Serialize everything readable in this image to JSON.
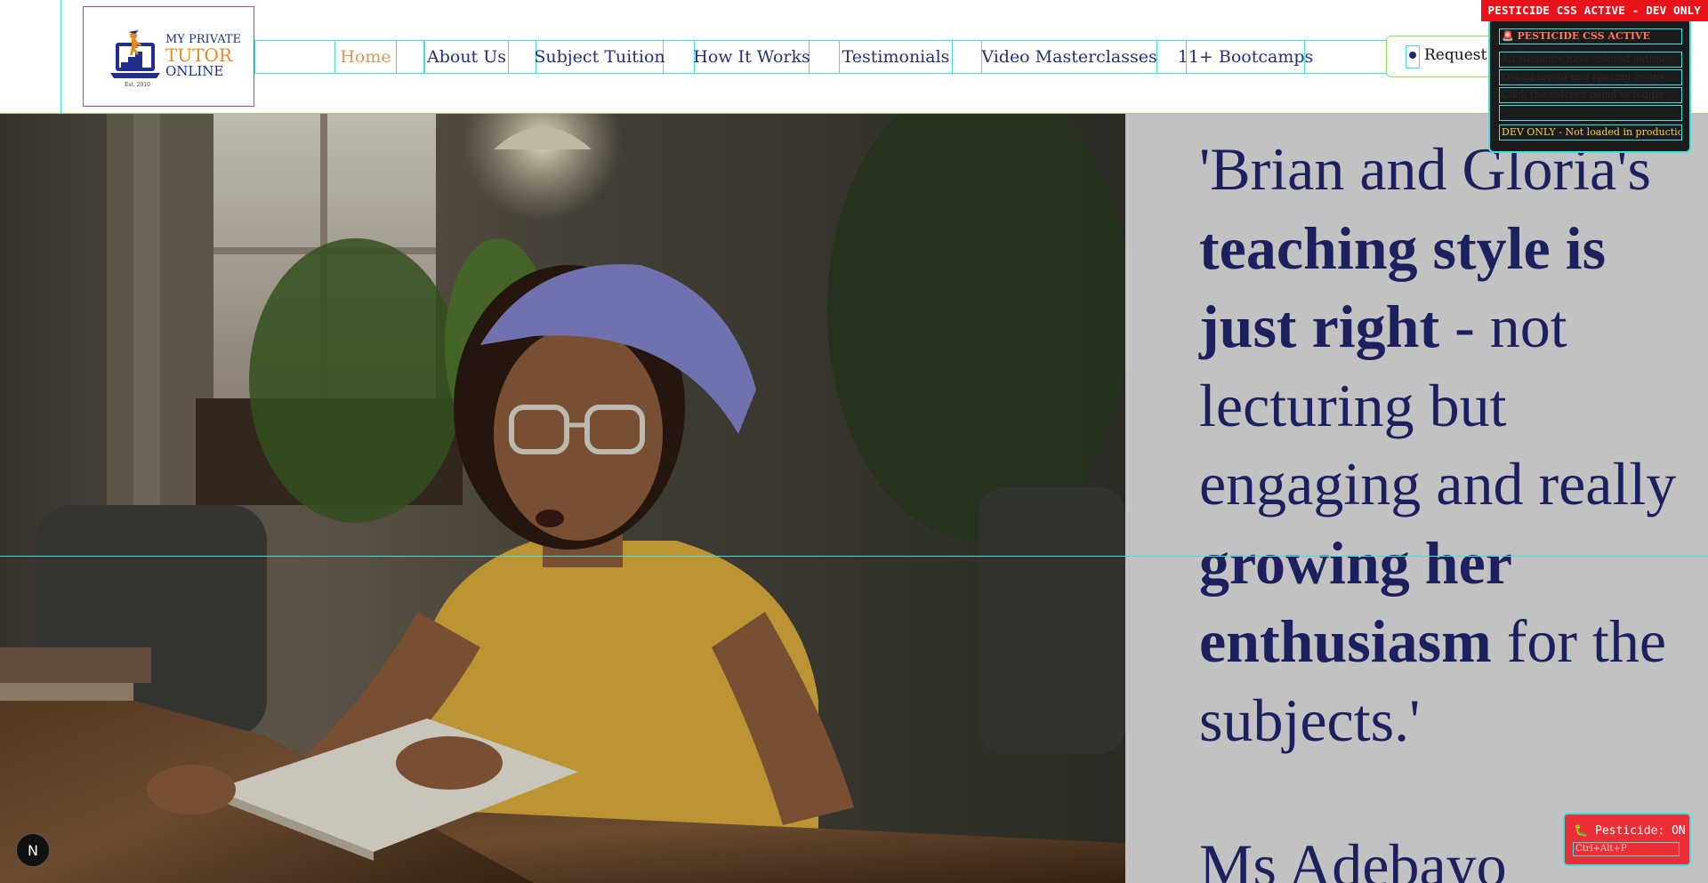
{
  "logo": {
    "line1": "MY PRIVATE",
    "line2": "TUTOR",
    "line3": "ONLINE",
    "est": "Est. 2010",
    "colors": {
      "navy": "#1f2f8a",
      "orange": "#e08a1e"
    }
  },
  "nav": {
    "items": [
      {
        "label": "Home",
        "active": true
      },
      {
        "label": "About Us",
        "active": false
      },
      {
        "label": "Subject Tuition",
        "active": false
      },
      {
        "label": "How It Works",
        "active": false
      },
      {
        "label": "Testimonials",
        "active": false
      },
      {
        "label": "Video Masterclasses",
        "active": false
      },
      {
        "label": "11+ Bootcamps",
        "active": false
      }
    ],
    "cta_label": "Request F"
  },
  "dev": {
    "badge": "PESTICIDE CSS ACTIVE - DEV ONLY",
    "panel_title": "🚨 PESTICIDE CSS ACTIVE",
    "panel_rows": [
      "All elements have colored outlines",
      "Debug layout and spacing issues",
      "Click the colored panel to toggle"
    ],
    "panel_footer": "DEV ONLY - Not loaded in production",
    "toggle_label": "🐛 Pesticide: ON",
    "toggle_shortcut": "Ctrl+Alt+P",
    "next_badge": "N"
  },
  "hero": {
    "quote_parts": [
      {
        "text": "'Brian and Gloria's ",
        "bold": false
      },
      {
        "text": "teaching style is just right",
        "bold": true
      },
      {
        "text": " - not lecturing but engaging and really ",
        "bold": false
      },
      {
        "text": "growing her enthusiasm",
        "bold": true
      },
      {
        "text": " for the subjects.'",
        "bold": false
      }
    ],
    "author": "Ms Adebayo",
    "colors": {
      "quote_text": "#1d205e",
      "panel_bg": "#c2c2c2"
    }
  }
}
